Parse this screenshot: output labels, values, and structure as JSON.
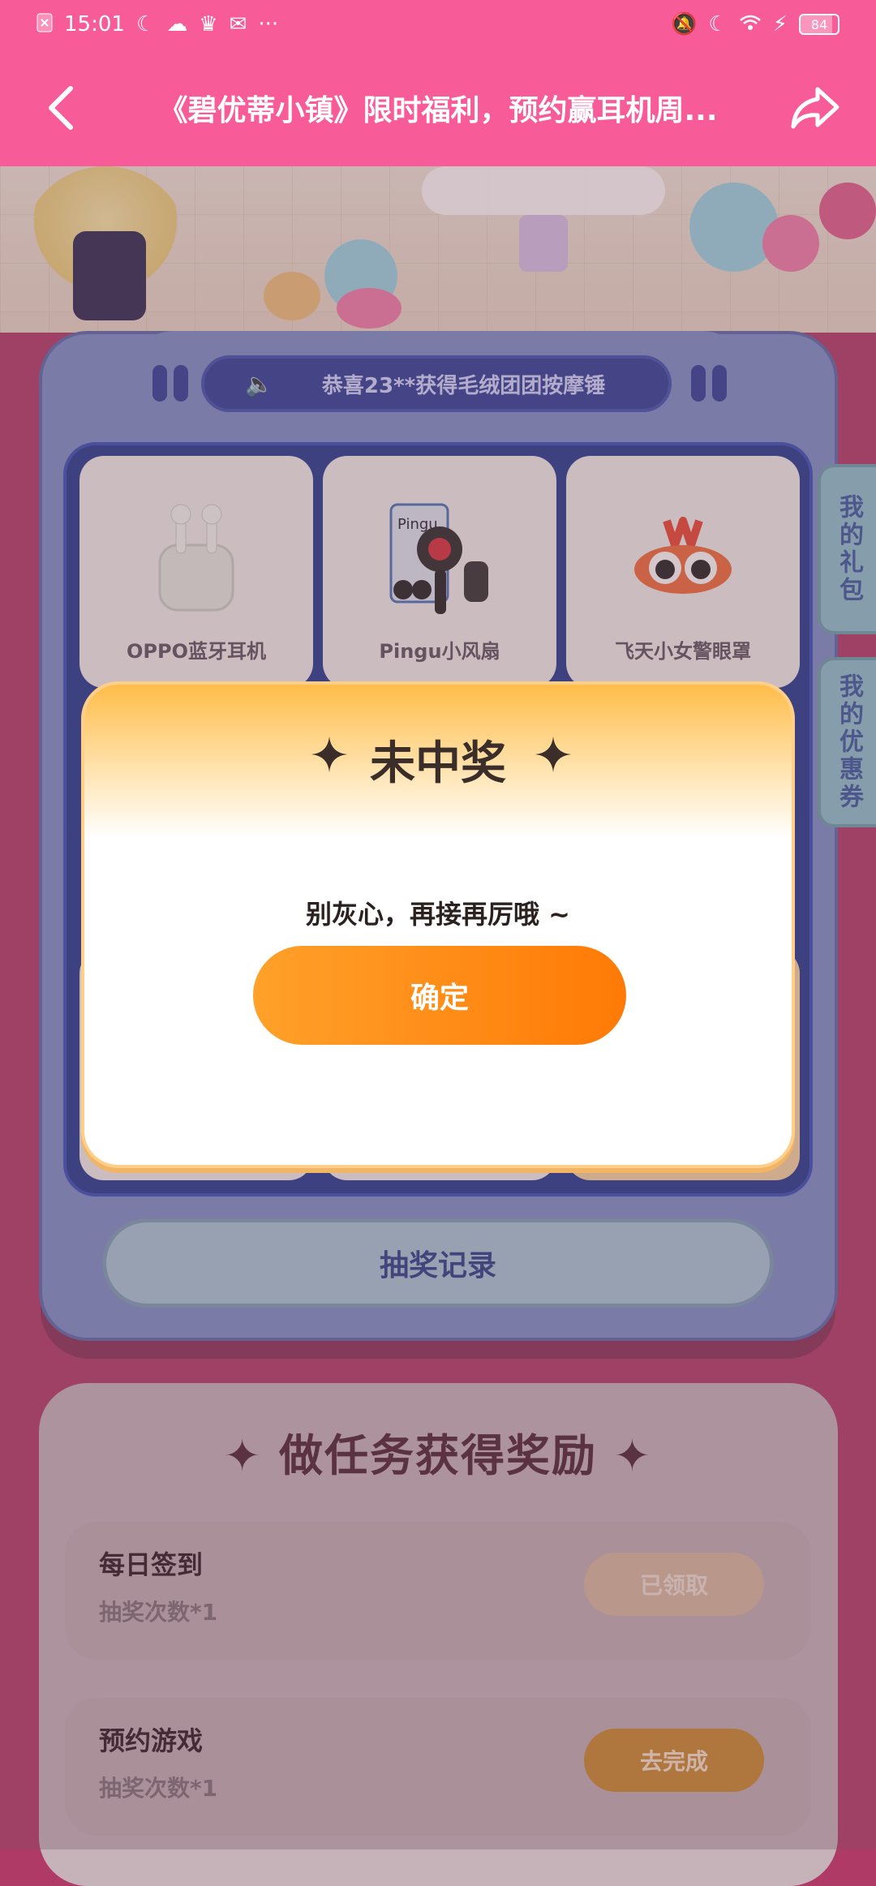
{
  "status_bar": {
    "time": "15:01",
    "battery": "84",
    "left_icons": [
      "notification-close-icon",
      "moon-icon",
      "cloud-icon",
      "crown-icon",
      "mail-icon",
      "more-icon"
    ],
    "right_icons": [
      "bell-off-icon",
      "moon-icon",
      "wifi-icon",
      "charging-icon",
      "battery-icon"
    ]
  },
  "navbar": {
    "title": "《碧优蒂小镇》限时福利，预约赢耳机周..."
  },
  "marquee": {
    "text": "恭喜23**获得毛绒团团按摩锤"
  },
  "prizes": [
    {
      "label": "OPPO蓝牙耳机"
    },
    {
      "label": "Pingu小风扇"
    },
    {
      "label": "飞天小女警眼罩"
    }
  ],
  "record_button": "抽奖记录",
  "side_tabs": {
    "gifts": "我的礼包",
    "coupons": "我的优惠券"
  },
  "tasks": {
    "title": "做任务获得奖励",
    "items": [
      {
        "name": "每日签到",
        "sub": "抽奖次数*1",
        "button": "已领取"
      },
      {
        "name": "预约游戏",
        "sub": "抽奖次数*1",
        "button": "去完成"
      }
    ]
  },
  "modal": {
    "title": "未中奖",
    "message": "别灰心，再接再厉哦 ~",
    "confirm": "确定"
  },
  "colors": {
    "header": "#f85c98",
    "board": "#7d8fc9",
    "modal_button": "#ff8a14"
  }
}
